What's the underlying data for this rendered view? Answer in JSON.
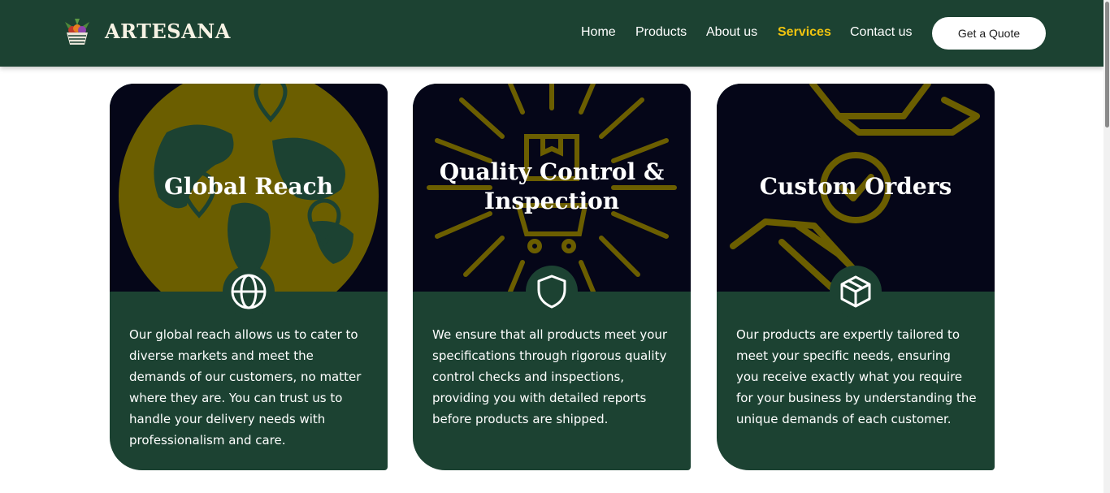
{
  "brand": {
    "name": "ARTESANA",
    "logo_icon": "fruit-basket-icon"
  },
  "nav": {
    "items": [
      {
        "label": "Home",
        "active": false
      },
      {
        "label": "Products",
        "active": false
      },
      {
        "label": "About us",
        "active": false
      },
      {
        "label": "Services",
        "active": true
      },
      {
        "label": "Contact us",
        "active": false
      }
    ],
    "cta_label": "Get a Quote"
  },
  "colors": {
    "primary": "#1c4232",
    "accent": "#f1c40f",
    "card_top": "#050618",
    "illustration": "#6b5e00"
  },
  "cards": [
    {
      "title": "Global Reach",
      "icon": "globe-icon",
      "text": "Our global reach allows us to cater to diverse markets and meet the demands of our customers, no matter where they are. You can trust us to handle your delivery needs with professionalism and care."
    },
    {
      "title": "Quality Control & Inspection",
      "icon": "shield-icon",
      "text": "We ensure that all products meet your specifications through rigorous quality control checks and inspections, providing you with detailed reports before products are shipped."
    },
    {
      "title": "Custom Orders",
      "icon": "box-icon",
      "text": "Our products are expertly tailored to meet your specific needs, ensuring you receive exactly what you require for your business by understanding the unique demands of each customer."
    }
  ]
}
